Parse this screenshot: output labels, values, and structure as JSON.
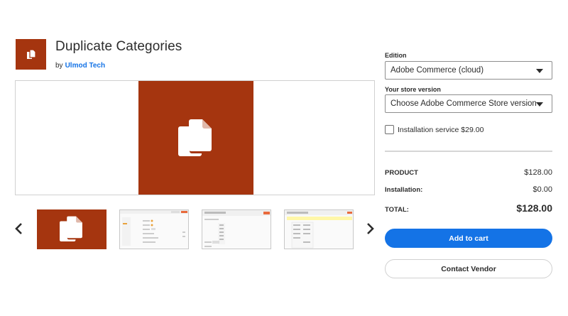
{
  "product": {
    "title": "Duplicate Categories",
    "by": "by",
    "vendor": "Ulmod Tech",
    "accent_color": "#a5350f"
  },
  "gallery": {
    "prev_icon": "chevron-left-icon",
    "next_icon": "chevron-right-icon",
    "main_icon": "duplicate-files-icon"
  },
  "sidebar": {
    "edition_label": "Edition",
    "edition_value": "Adobe Commerce (cloud)",
    "store_version_label": "Your store version",
    "store_version_value": "Choose Adobe Commerce Store version",
    "installation_service_label": "Installation service $29.00",
    "installation_service_checked": false,
    "summary": {
      "product_label": "PRODUCT",
      "product_value": "$128.00",
      "installation_label": "Installation:",
      "installation_value": "$0.00",
      "total_label": "TOTAL:",
      "total_value": "$128.00"
    },
    "add_to_cart": "Add to cart",
    "contact_vendor": "Contact Vendor",
    "button_color": "#1473e6"
  }
}
